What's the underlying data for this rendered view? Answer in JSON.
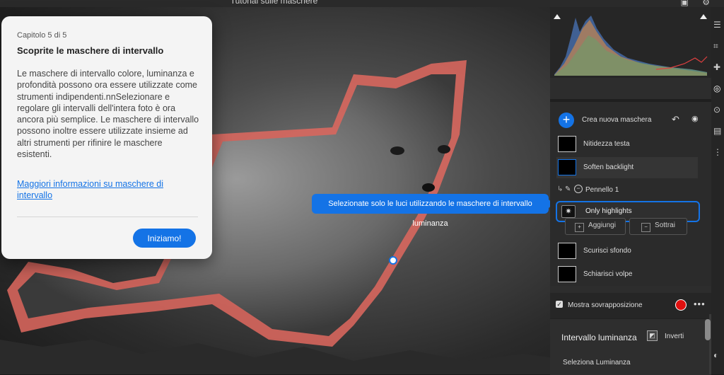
{
  "window": {
    "title": "Tutorial sulle maschere"
  },
  "tutorial": {
    "chapter": "Capitolo 5 di 5",
    "title": "Scoprite le maschere di intervallo",
    "body": "Le maschere di intervallo colore, luminanza e profondità possono ora essere utilizzate come strumenti indipendenti.nnSelezionare e regolare gli intervalli dell'intera foto è ora ancora più semplice. Le maschere di intervallo possono inoltre essere utilizzate insieme ad altri strumenti per rifinire le maschere esistenti.",
    "link": "Maggiori informazioni su maschere di intervallo",
    "start_button": "Iniziamo!"
  },
  "callout": {
    "text": "Selezionate solo le luci utilizzando le maschere di intervallo luminanza"
  },
  "masks_panel": {
    "create_label": "Crea nuova maschera",
    "items": [
      {
        "name": "Nitidezza testa"
      },
      {
        "name": "Soften backlight"
      },
      {
        "name": "Scurisci sfondo"
      },
      {
        "name": "Schiarisci volpe"
      }
    ],
    "brush": "Pennello 1",
    "range_item": "Only highlights",
    "add_button": "Aggiungi",
    "subtract_button": "Sottrai"
  },
  "overlay": {
    "label": "Mostra sovrapposizione",
    "color": "#e0100f",
    "checked": true
  },
  "luminance_panel": {
    "title": "Intervallo luminanza",
    "invert": "Inverti",
    "select_label": "Seleziona Luminanza"
  },
  "colors": {
    "accent": "#1473e6",
    "mask_overlay": "#e0685f"
  }
}
